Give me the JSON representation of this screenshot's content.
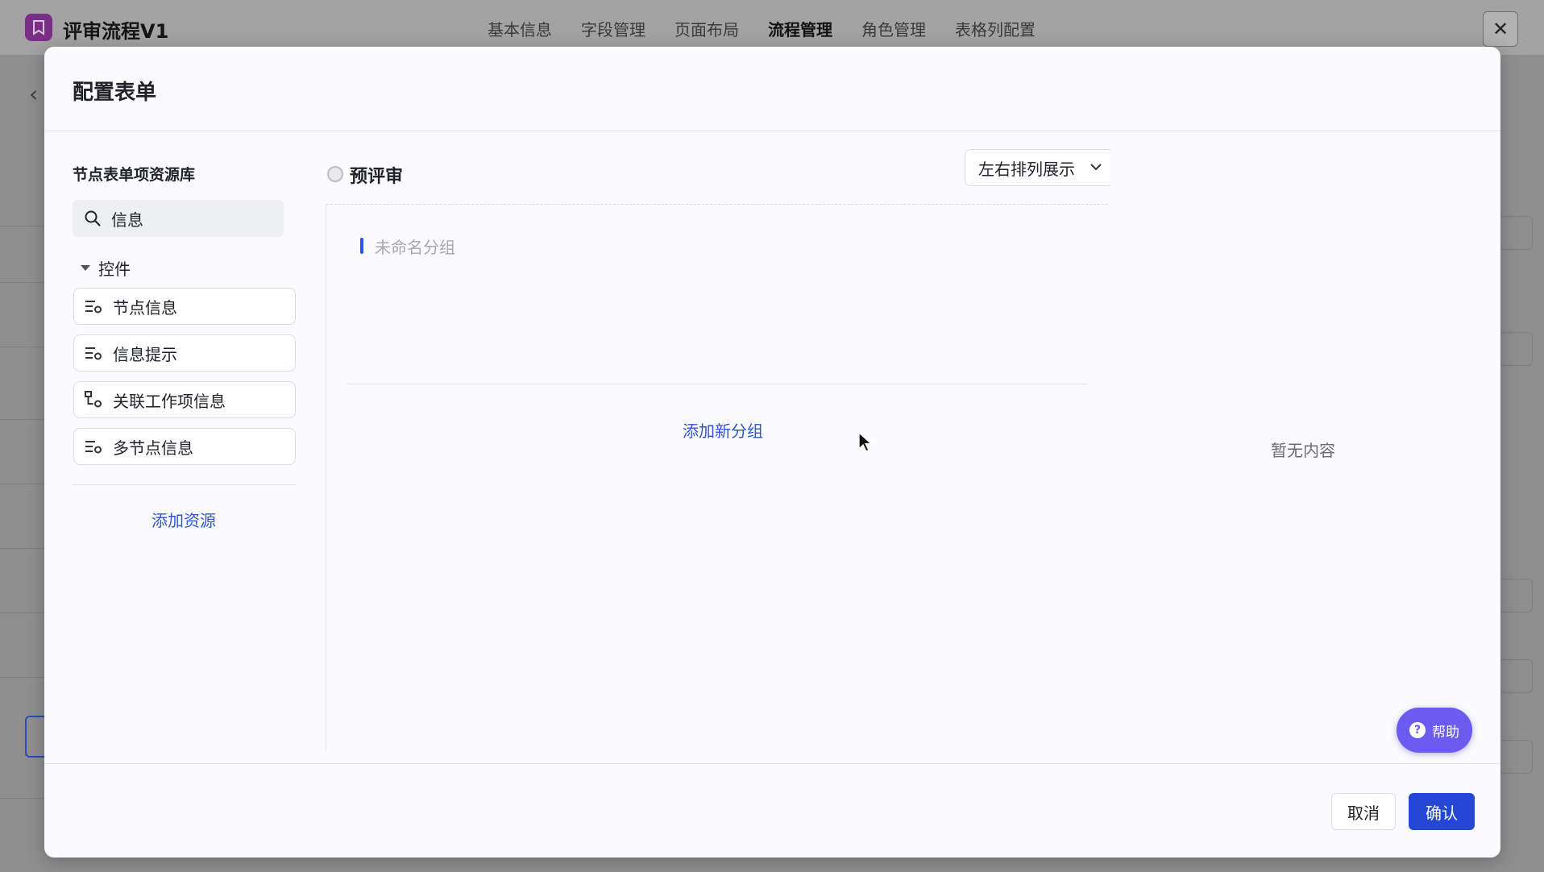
{
  "app": {
    "title": "评审流程V1"
  },
  "tabs": [
    "基本信息",
    "字段管理",
    "页面布局",
    "流程管理",
    "角色管理",
    "表格列配置"
  ],
  "modal": {
    "title": "配置表单",
    "library": {
      "title": "节点表单项资源库",
      "search_value": "信息",
      "group_label": "控件",
      "items": [
        "节点信息",
        "信息提示",
        "关联工作项信息",
        "多节点信息"
      ],
      "add_resource": "添加资源"
    },
    "node": {
      "name": "预评审",
      "layout_option": "左右排列展示",
      "group_name": "未命名分组",
      "add_group": "添加新分组"
    },
    "empty_text": "暂无内容",
    "help_label": "帮助",
    "cancel_label": "取消",
    "ok_label": "确认"
  },
  "colors": {
    "accent": "#2d55d6",
    "primary_button": "#2447d8",
    "help": "#6b5bf0"
  }
}
